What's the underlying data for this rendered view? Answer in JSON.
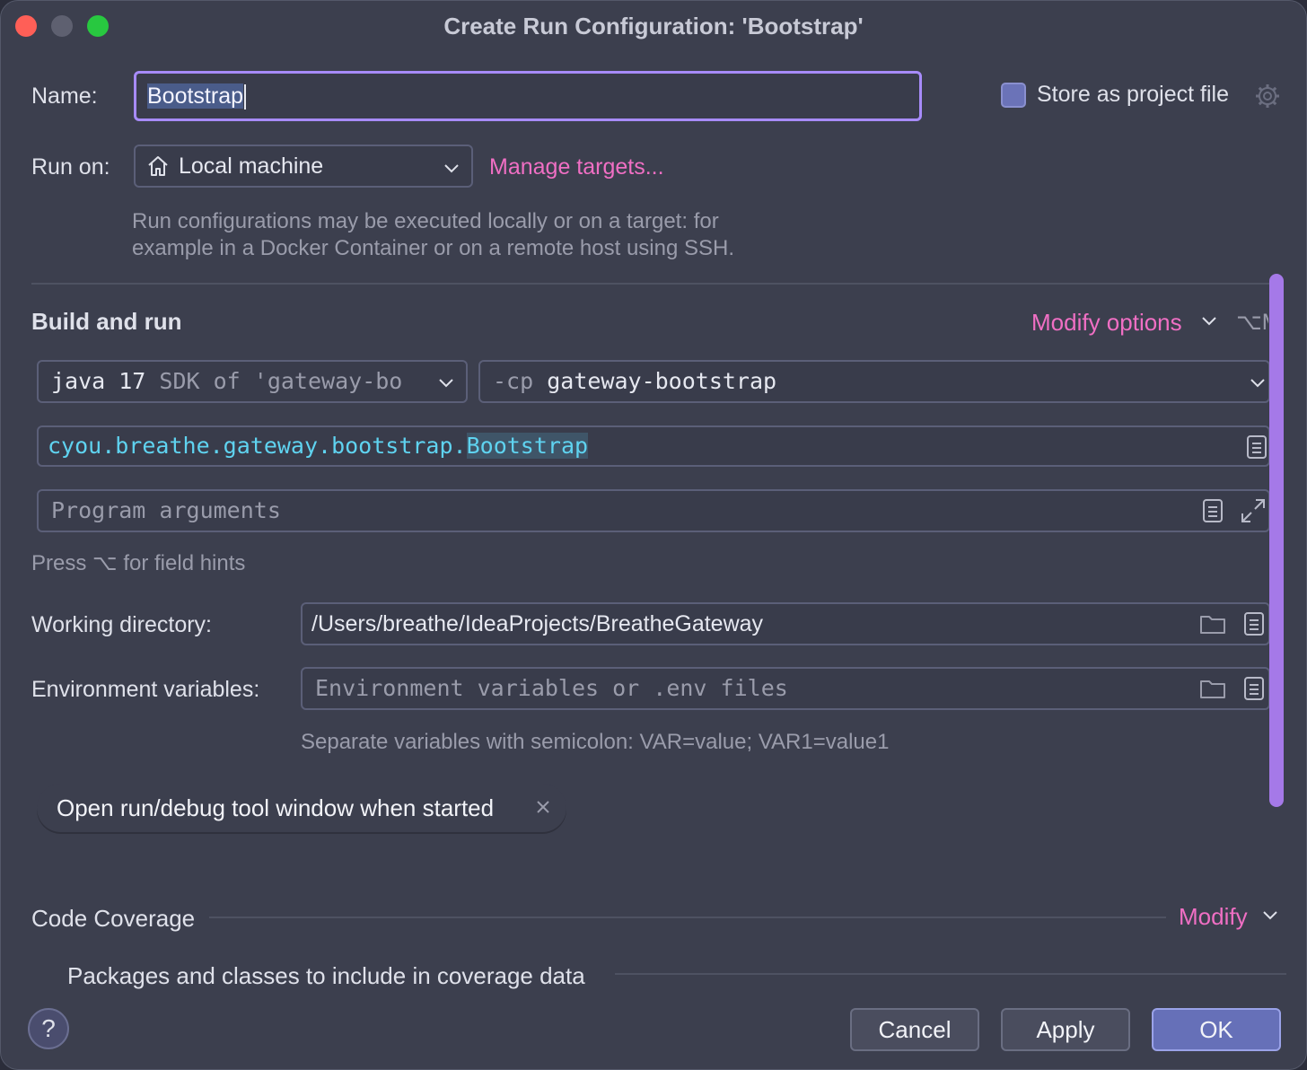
{
  "window": {
    "title": "Create Run Configuration: 'Bootstrap'"
  },
  "name": {
    "label": "Name:",
    "value": "Bootstrap"
  },
  "store_project_file": {
    "label": "Store as project file",
    "checked": false
  },
  "run_on": {
    "label": "Run on:",
    "selected": "Local machine",
    "manage_link": "Manage targets...",
    "hint_line1": "Run configurations may be executed locally or on a target: for",
    "hint_line2": "example in a Docker Container or on a remote host using SSH."
  },
  "build_and_run": {
    "title": "Build and run",
    "modify_options": "Modify options",
    "shortcut": "⌥M",
    "jdk": {
      "prefix": "java 17",
      "suffix": "SDK of 'gateway-bo"
    },
    "classpath": {
      "prefix": "-cp",
      "module": "gateway-bootstrap"
    },
    "main_class": {
      "package": "cyou.breathe.gateway.bootstrap.",
      "class": "Bootstrap"
    },
    "program_args_placeholder": "Program arguments",
    "field_hint": "Press ⌥ for field hints"
  },
  "working_directory": {
    "label": "Working directory:",
    "value": "/Users/breathe/IdeaProjects/BreatheGateway"
  },
  "env_vars": {
    "label": "Environment variables:",
    "placeholder": "Environment variables or .env files",
    "hint": "Separate variables with semicolon: VAR=value; VAR1=value1"
  },
  "chip": {
    "label": "Open run/debug tool window when started"
  },
  "code_coverage": {
    "title": "Code Coverage",
    "modify": "Modify",
    "packages_label": "Packages and classes to include in coverage data"
  },
  "buttons": {
    "help": "?",
    "cancel": "Cancel",
    "apply": "Apply",
    "ok": "OK"
  },
  "colors": {
    "accent_link": "#f06fc4",
    "focus": "#a78bfa",
    "ok_button": "#6670b8"
  }
}
